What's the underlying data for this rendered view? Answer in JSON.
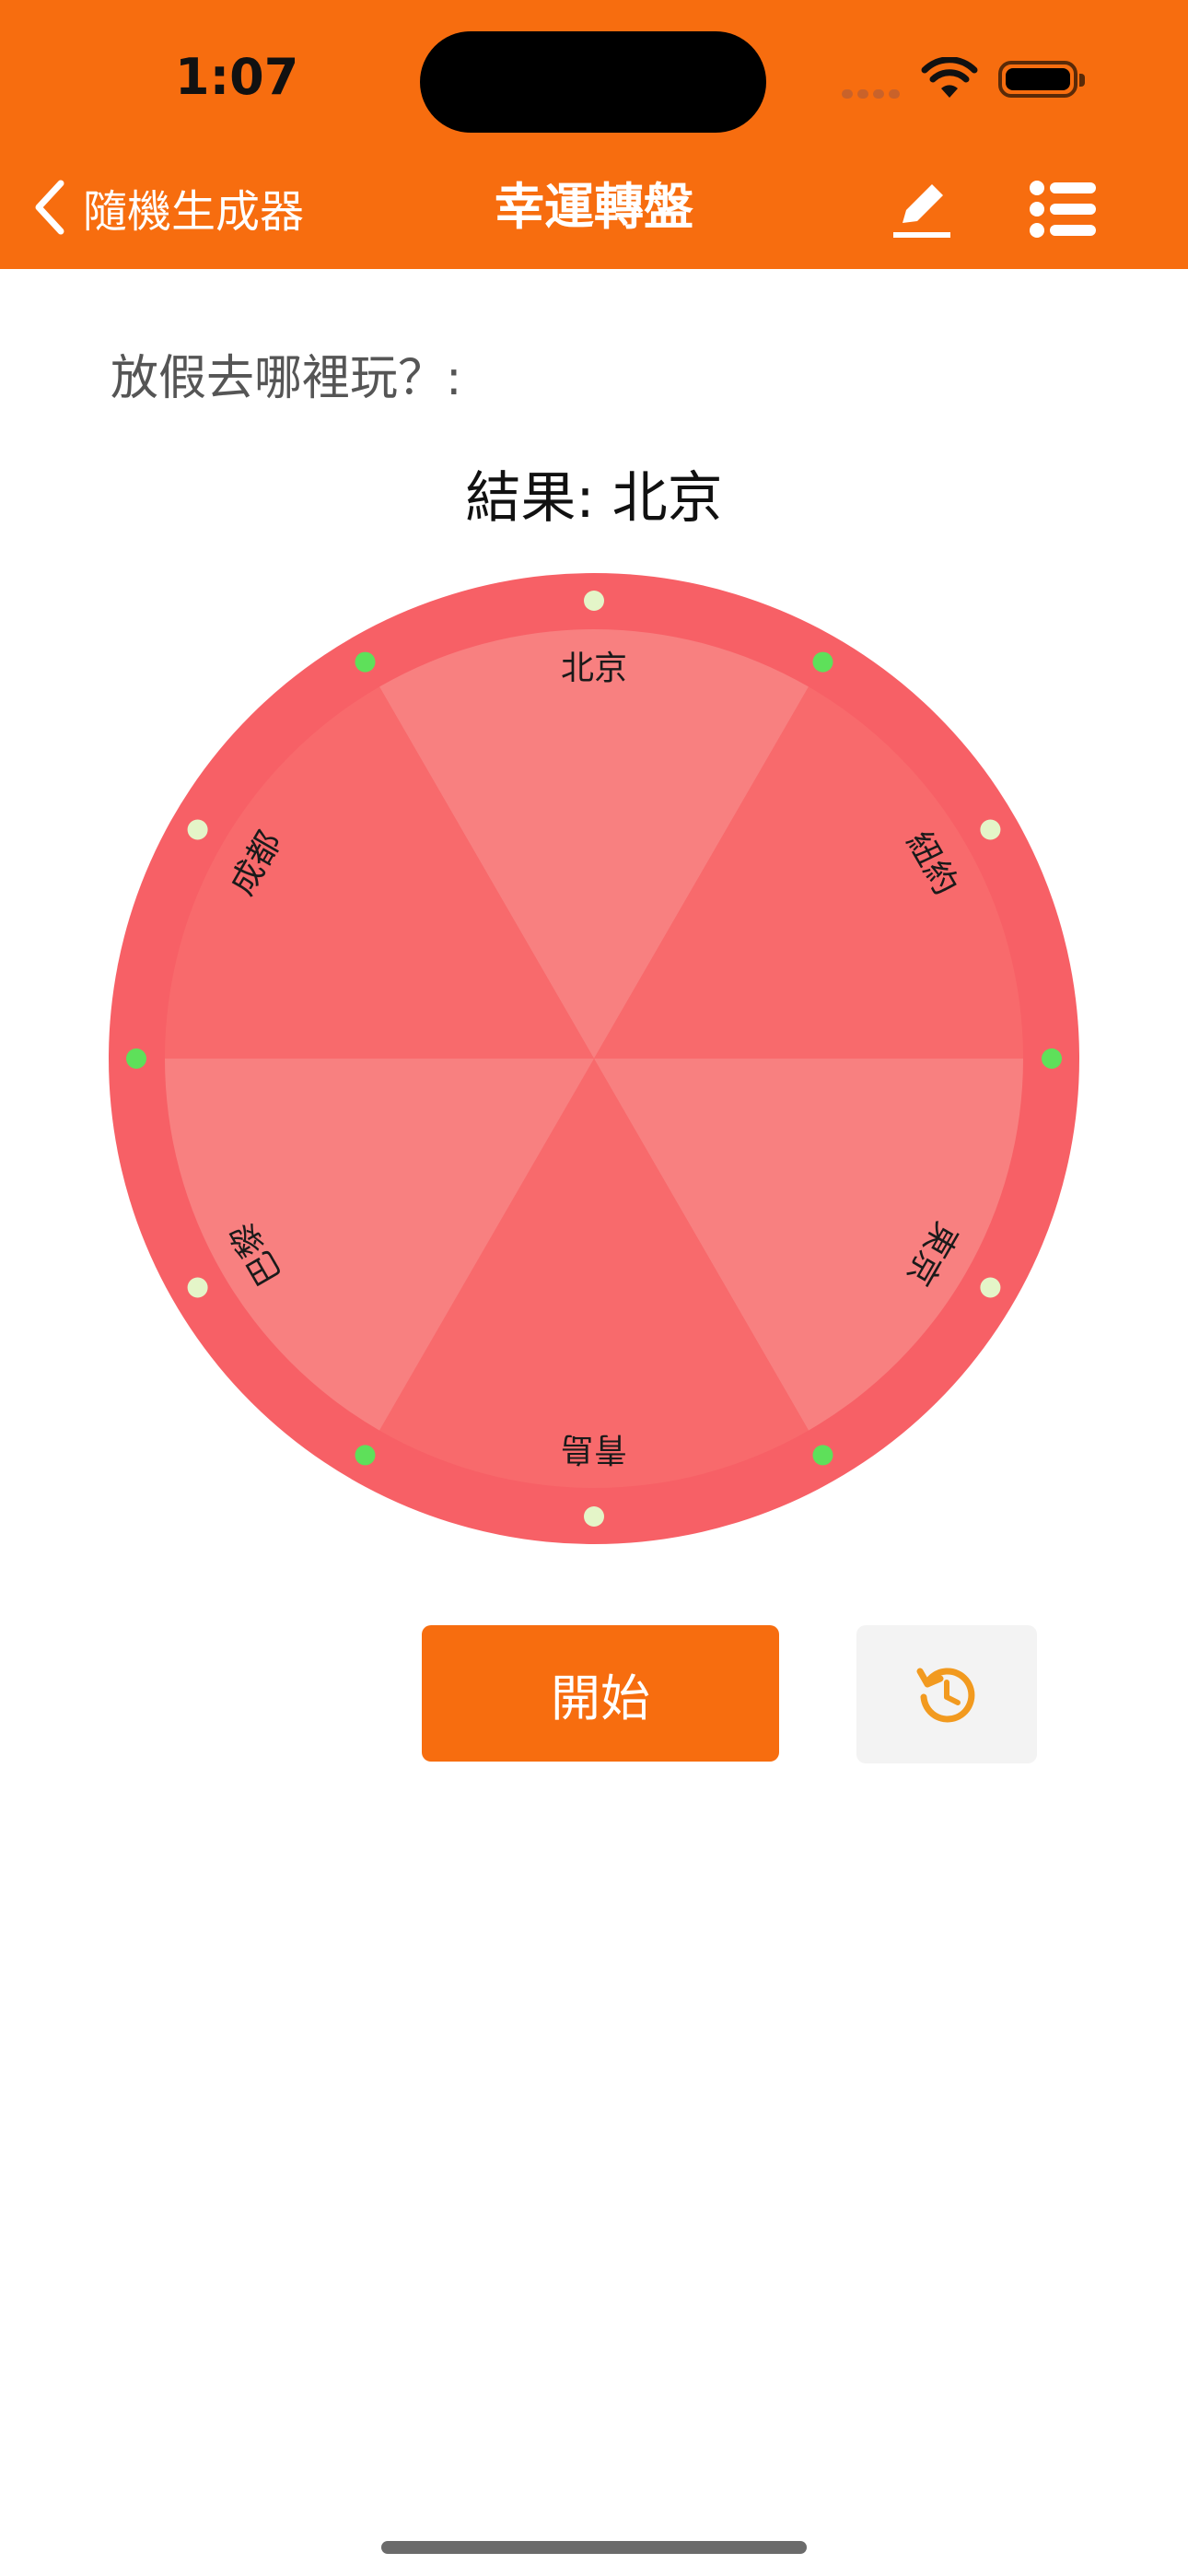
{
  "status_bar": {
    "time": "1:07"
  },
  "nav": {
    "back_label": "隨機生成器",
    "title": "幸運轉盤",
    "edit_icon": "pencil-icon",
    "list_icon": "list-icon"
  },
  "question": "放假去哪裡玩？:",
  "result": {
    "label": "結果: ",
    "value": "北京"
  },
  "wheel": {
    "segments": [
      {
        "label": "北京",
        "color": "#f88080"
      },
      {
        "label": "紐約",
        "color": "#f86a6c"
      },
      {
        "label": "東京",
        "color": "#f88080"
      },
      {
        "label": "青島",
        "color": "#f86a6c"
      },
      {
        "label": "巴黎",
        "color": "#f88080"
      },
      {
        "label": "成都",
        "color": "#f86a6c"
      }
    ],
    "rim_color": "#f76066",
    "light_colors": [
      "#e4f5c8",
      "#5ee05a"
    ]
  },
  "buttons": {
    "start_label": "開始",
    "reset_icon": "history-reset-icon"
  },
  "colors": {
    "accent": "#f76d0f"
  }
}
